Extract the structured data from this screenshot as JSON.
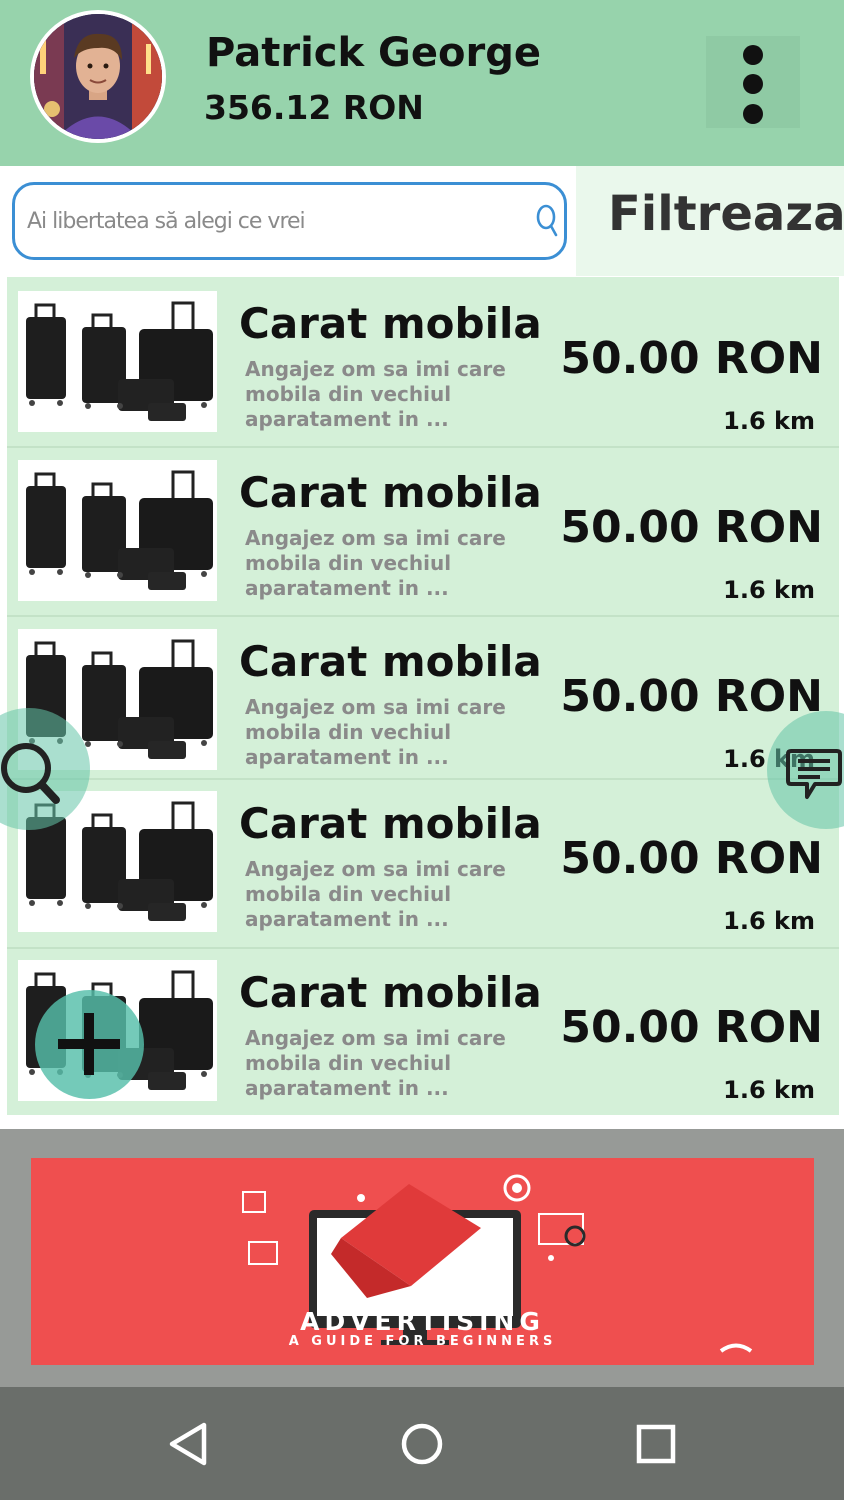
{
  "header": {
    "user_name": "Patrick George",
    "balance": "356.12 RON",
    "avatar_icon": "user-avatar",
    "menu_icon": "more-vertical-icon"
  },
  "search": {
    "placeholder": "Ai libertatea să alegi ce vrei",
    "icon": "search-icon"
  },
  "filter": {
    "label": "Filtreaza"
  },
  "listings": [
    {
      "title": "Carat mobila",
      "description": "Angajez om sa imi care mobila din vechiul aparatament in ...",
      "price": "50.00 RON",
      "distance": "1.6 km",
      "image": "luggage-set"
    },
    {
      "title": "Carat mobila",
      "description": "Angajez om sa imi care mobila din vechiul aparatament in ...",
      "price": "50.00 RON",
      "distance": "1.6 km",
      "image": "luggage-set"
    },
    {
      "title": "Carat mobila",
      "description": "Angajez om sa imi care mobila din vechiul aparatament in ...",
      "price": "50.00 RON",
      "distance": "1.6 km",
      "image": "luggage-set"
    },
    {
      "title": "Carat mobila",
      "description": "Angajez om sa imi care mobila din vechiul aparatament in ...",
      "price": "50.00 RON",
      "distance": "1.6 km",
      "image": "luggage-set"
    },
    {
      "title": "Carat mobila",
      "description": "Angajez om sa imi care mobila din vechiul aparatament in ...",
      "price": "50.00 RON",
      "distance": "1.6 km",
      "image": "luggage-set"
    }
  ],
  "floating_buttons": {
    "search_icon": "search-icon",
    "chat_icon": "chat-icon",
    "add_icon": "plus-icon"
  },
  "ad": {
    "title": "ADVERTISING",
    "subtitle": "A GUIDE FOR BEGINNERS"
  },
  "nav_bar": {
    "back_icon": "back-triangle-icon",
    "home_icon": "home-circle-icon",
    "recents_icon": "recents-square-icon"
  },
  "colors": {
    "header_bg": "#97d3ac",
    "list_bg": "#d4f0d8",
    "filter_bg": "#eaf8ec",
    "search_border": "#3b8fd4",
    "fab": "#64c4a8",
    "ad_bg": "#ef4f4f",
    "ad_area_bg": "#979a97",
    "nav_bg": "#6a6e6a"
  }
}
